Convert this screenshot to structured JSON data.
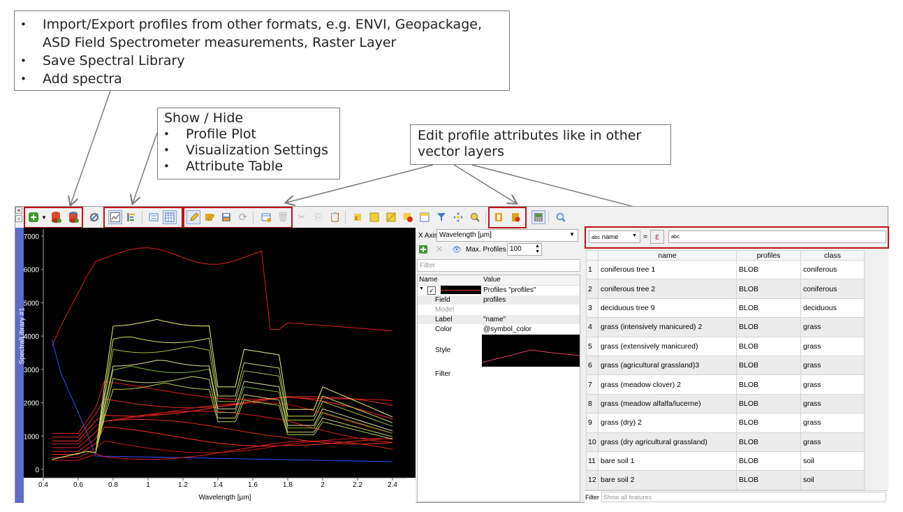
{
  "callouts": {
    "top": [
      "Import/Export profiles from other formats,  e.g. ENVI, Geopackage, ASD Field Spectrometer measurements, Raster Layer",
      "Save Spectral Library",
      "Add spectra"
    ],
    "show_hide": {
      "title": "Show / Hide",
      "items": [
        "Profile Plot",
        "Visualization Settings",
        "Attribute Table"
      ]
    },
    "edit": "Edit profile attributes like in other vector layers"
  },
  "plot": {
    "side_label": "SpectralLibrary #1",
    "xlabel": "Wavelength [µm]",
    "x_ticks": [
      "0.4",
      "0.6",
      "0.8",
      "1",
      "1.2",
      "1.4",
      "1.6",
      "1.8",
      "2",
      "2.2",
      "2.4"
    ],
    "y_ticks": [
      "7000",
      "6000",
      "5000",
      "4000",
      "3000",
      "2000",
      "1000",
      "0"
    ]
  },
  "visualization": {
    "x_axis_label": "X Axis",
    "x_axis_value": "Wavelength [µm]",
    "max_profiles_label": "Max. Profiles",
    "max_profiles_value": "100",
    "filter_placeholder": "Filter",
    "col_name": "Name",
    "col_value": "Value",
    "profiles_value": "Profiles \"profiles\"",
    "rows": [
      {
        "name": "Field",
        "value": "profiles"
      },
      {
        "name": "Model",
        "value": ""
      },
      {
        "name": "Label",
        "value": "\"name\""
      },
      {
        "name": "Color",
        "value": "@symbol_color"
      },
      {
        "name": "Style",
        "value": ""
      },
      {
        "name": "Filter",
        "value": ""
      }
    ]
  },
  "attribute_table": {
    "field_select": "name",
    "field_type": "abc",
    "equals": "=",
    "expr_icon": "ε",
    "value_type": "abc",
    "columns": [
      "name",
      "profiles",
      "class"
    ],
    "rows": [
      [
        "1",
        "coniferous tree 1",
        "BLOB",
        "coniferous"
      ],
      [
        "2",
        "coniferous tree 2",
        "BLOB",
        "coniferous"
      ],
      [
        "3",
        "deciduous tree 9",
        "BLOB",
        "deciduous"
      ],
      [
        "4",
        "grass (intensively manicured) 2",
        "BLOB",
        "grass"
      ],
      [
        "5",
        "grass (extensively manicured)",
        "BLOB",
        "grass"
      ],
      [
        "6",
        "grass (agricultural grassland)3",
        "BLOB",
        "grass"
      ],
      [
        "7",
        "grass (meadow clover) 2",
        "BLOB",
        "grass"
      ],
      [
        "8",
        "grass (meadow alfalfa/lucerne)",
        "BLOB",
        "grass"
      ],
      [
        "9",
        "grass (dry) 2",
        "BLOB",
        "grass"
      ],
      [
        "10",
        "grass (dry agricultural grassland)",
        "BLOB",
        "grass"
      ],
      [
        "11",
        "bare soil 1",
        "BLOB",
        "soil"
      ],
      [
        "12",
        "bare soil 2",
        "BLOB",
        "soil"
      ]
    ],
    "filter_label": "Filter",
    "filter_placeholder": "Show all features"
  },
  "colors": {
    "highlight": "#c0101a",
    "plot_bg": "#000000",
    "side_bar": "#5b6dcb"
  }
}
